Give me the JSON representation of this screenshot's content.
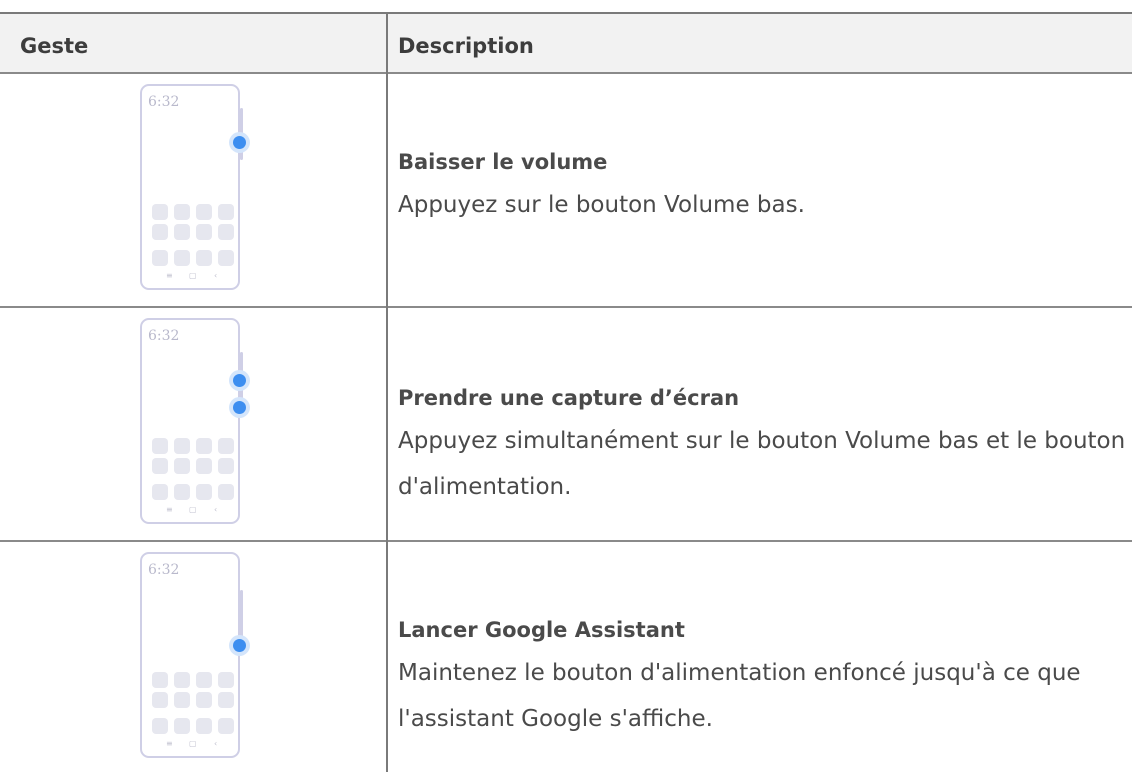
{
  "table": {
    "headers": {
      "gesture": "Geste",
      "description": "Description"
    },
    "rows": [
      {
        "title": "Baisser le volume",
        "description": "Appuyez sur le bouton Volume bas.",
        "illustration": {
          "time": "6:32",
          "pressed_keys": [
            "volume-down"
          ]
        }
      },
      {
        "title": "Prendre une capture d’écran",
        "description": "Appuyez simultanément sur le bouton Volume bas et le bouton d'alimentation.",
        "illustration": {
          "time": "6:32",
          "pressed_keys": [
            "volume-down",
            "power"
          ]
        }
      },
      {
        "title": "Lancer Google Assistant",
        "description": "Maintenez le bouton d'alimentation enfoncé jusqu'à ce que l'assistant Google s'affiche.",
        "illustration": {
          "time": "6:32",
          "pressed_keys": [
            "power"
          ]
        }
      }
    ]
  },
  "phone_nav_icons": [
    "menu-icon",
    "home-icon",
    "back-icon"
  ],
  "colors": {
    "press_dot": "#3d8ef0",
    "phone_outline": "#cfcfe6",
    "header_background": "#f2f2f2"
  }
}
